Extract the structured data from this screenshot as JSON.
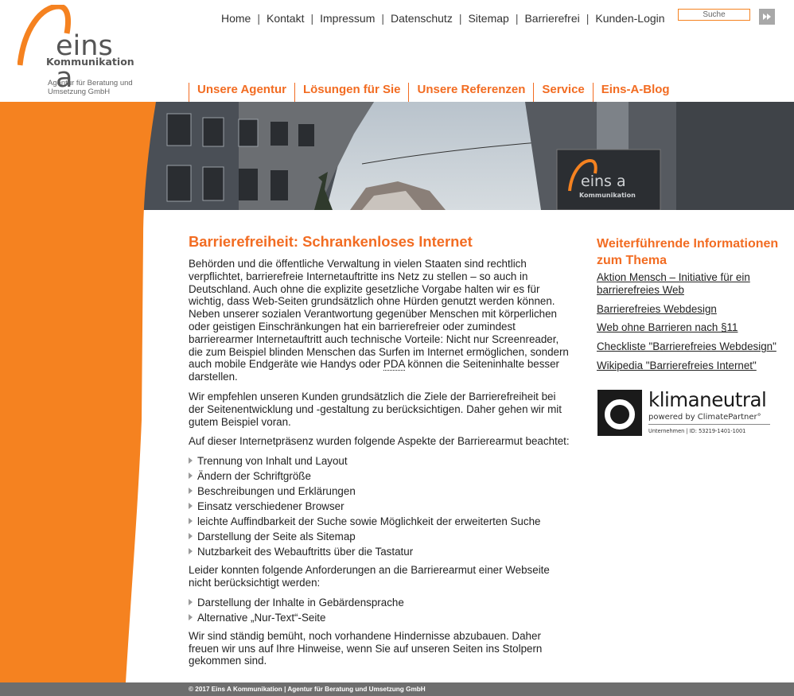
{
  "brand": {
    "name": "eins a",
    "sub": "Kommunikation",
    "tagline": "Agentur für Beratung und Umsetzung GmbH",
    "accent_color": "#f58220",
    "heading_color": "#f26c22"
  },
  "topnav": {
    "items": [
      "Home",
      "Kontakt",
      "Impressum",
      "Datenschutz",
      "Sitemap",
      "Barrierefrei",
      "Kunden-Login"
    ]
  },
  "search": {
    "value": "Suche",
    "button_icon": "fast-forward-icon"
  },
  "mainnav": {
    "items": [
      "Unsere Agentur",
      "Lösungen für Sie",
      "Unsere Referenzen",
      "Service",
      "Eins-A-Blog"
    ]
  },
  "hero": {
    "sign_text": "eins a",
    "sign_sub": "Kommunikation"
  },
  "article": {
    "title": "Barrierefreiheit: Schrankenloses Internet",
    "p1_before": "Behörden und die öffentliche Verwaltung in vielen Staaten sind rechtlich verpflichtet, barrierefreie Internetauftritte ins Netz zu stellen – so auch in Deutschland. Auch ohne die explizite gesetzliche Vorgabe halten wir es für wichtig, dass Web-Seiten grundsätzlich ohne Hürden genutzt werden können. Neben unserer sozialen Verantwortung gegenüber Menschen mit körperlichen oder geistigen Einschränkungen hat ein barrierefreier oder zumindest barrierearmer Internetauftritt auch technische Vorteile: Nicht nur Screenreader, die zum Beispiel blinden Menschen das Surfen im Internet ermöglichen, sondern auch mobile Endgeräte wie Handys oder ",
    "p1_abbr": "PDA",
    "p1_after": " können die Seiteninhalte besser darstellen.",
    "p2": "Wir empfehlen unseren Kunden grundsätzlich die Ziele der Barrierefreiheit bei der Seitenentwicklung und -gestaltung zu berücksichtigen. Daher gehen wir mit gutem Beispiel voran.",
    "p3": "Auf dieser Internetpräsenz wurden folgende Aspekte der Barrierearmut beachtet:",
    "list1": [
      "Trennung von Inhalt und Layout",
      "Ändern der Schriftgröße",
      "Beschreibungen und Erklärungen",
      "Einsatz verschiedener Browser",
      "leichte Auffindbarkeit der Suche sowie Möglichkeit der erweiterten Suche",
      "Darstellung der Seite als Sitemap",
      "Nutzbarkeit des Webauftritts über die Tastatur"
    ],
    "p4": "Leider konnten folgende Anforderungen an die Barrierearmut einer Webseite nicht berücksichtigt werden:",
    "list2": [
      "Darstellung der Inhalte in Gebärdensprache",
      "Alternative „Nur-Text“-Seite"
    ],
    "p5": "Wir sind ständig bemüht, noch vorhandene Hindernisse abzubauen. Daher freuen wir uns auf Ihre Hinweise, wenn Sie auf unseren Seiten ins Stolpern gekommen sind."
  },
  "sidebar": {
    "title": "Weiterführende Informationen zum Thema",
    "links": [
      "Aktion Mensch – Initiative für ein barrierefreies Web",
      "Barrierefreies Webdesign",
      "Web ohne Barrieren nach §11",
      "Checkliste \"Barrierefreies Webdesign\"",
      "Wikipedia \"Barrierefreies Internet\""
    ]
  },
  "klimaneutral": {
    "title": "klimaneutral",
    "powered": "powered by ClimatePartner°",
    "id": "Unternehmen | ID: 53219-1401-1001"
  },
  "footer": {
    "text": "© 2017 Eins A Kommunikation | Agentur für Beratung und Umsetzung GmbH"
  }
}
